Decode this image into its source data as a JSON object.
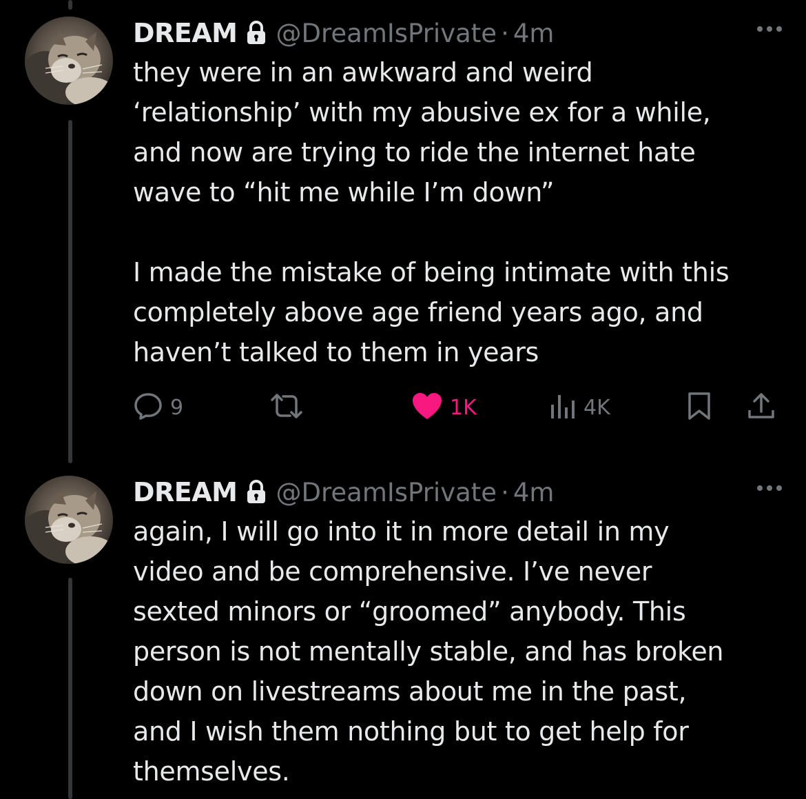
{
  "colors": {
    "background": "#000000",
    "text": "#e7e9ea",
    "muted": "#71767b",
    "like": "#f91880",
    "thread_line": "#333639"
  },
  "tweets": [
    {
      "display_name": "DREAM",
      "handle": "@DreamIsPrivate",
      "separator": "·",
      "time": "4m",
      "avatar_icon": "cat-avatar",
      "text": "they were in an awkward and weird\n‘relationship’ with my abusive ex for a while,\nand now are trying to ride the internet hate\nwave to “hit me while I’m down”\n\nI made the mistake of being intimate with this\ncompletely above age friend years ago, and\nhaven’t talked to them in years",
      "actions": {
        "replies": "9",
        "likes": "1K",
        "views": "4K"
      }
    },
    {
      "display_name": "DREAM",
      "handle": "@DreamIsPrivate",
      "separator": "·",
      "time": "4m",
      "avatar_icon": "cat-avatar",
      "text": "again, I will go into it in more detail in my\nvideo and be comprehensive. I’ve never\nsexted minors or “groomed” anybody. This\nperson is not mentally stable, and has broken\ndown on livestreams about me in the past,\nand I wish them nothing but to get help for\nthemselves."
    }
  ]
}
